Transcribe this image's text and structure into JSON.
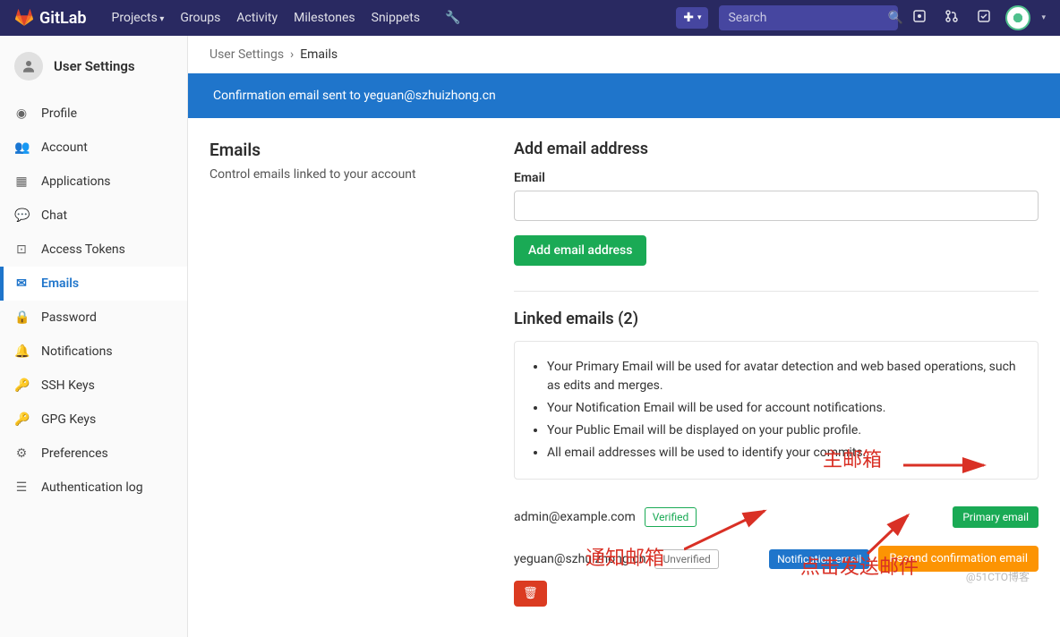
{
  "brand": "GitLab",
  "nav": {
    "projects": "Projects",
    "groups": "Groups",
    "activity": "Activity",
    "milestones": "Milestones",
    "snippets": "Snippets"
  },
  "search": {
    "placeholder": "Search"
  },
  "breadcrumb": {
    "root": "User Settings",
    "current": "Emails"
  },
  "sidebar": {
    "title": "User Settings",
    "items": [
      {
        "label": "Profile"
      },
      {
        "label": "Account"
      },
      {
        "label": "Applications"
      },
      {
        "label": "Chat"
      },
      {
        "label": "Access Tokens"
      },
      {
        "label": "Emails"
      },
      {
        "label": "Password"
      },
      {
        "label": "Notifications"
      },
      {
        "label": "SSH Keys"
      },
      {
        "label": "GPG Keys"
      },
      {
        "label": "Preferences"
      },
      {
        "label": "Authentication log"
      }
    ]
  },
  "alert": "Confirmation email sent to yeguan@szhuizhong.cn",
  "left": {
    "title": "Emails",
    "subtitle": "Control emails linked to your account"
  },
  "add": {
    "title": "Add email address",
    "label": "Email",
    "button": "Add email address"
  },
  "linked": {
    "title": "Linked emails (2)",
    "info": [
      "Your Primary Email will be used for avatar detection and web based operations, such as edits and merges.",
      "Your Notification Email will be used for account notifications.",
      "Your Public Email will be displayed on your public profile.",
      "All email addresses will be used to identify your commits."
    ],
    "rows": [
      {
        "email": "admin@example.com",
        "verified": "Verified",
        "primary": "Primary email"
      },
      {
        "email": "yeguan@szhuizhong.cn",
        "unverified": "Unverified",
        "notification": "Notification email",
        "resend": "Resend confirmation email"
      }
    ]
  },
  "annotations": {
    "primary_mailbox": "主邮箱",
    "notification_mailbox": "通知邮箱",
    "click_send": "点击发送邮件"
  },
  "watermark": "@51CTO博客"
}
